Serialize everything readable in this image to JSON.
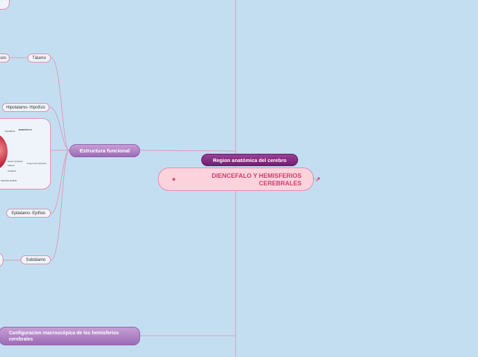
{
  "central": {
    "title": "DIENCEFALO Y HEMISFERIOS CEREBRALES",
    "icon": "brain-icon"
  },
  "region": {
    "label": "Region anatómica del cerebro"
  },
  "estructura": {
    "label": "Estructura funcional"
  },
  "configuracion": {
    "label": "Configuracion macroscópica de los hemisferios cerebrales"
  },
  "children": {
    "talamo_partial": "oro",
    "talamo": "Tálamo",
    "hipotalamo": "Hipotalamo- Hipofisis",
    "epitalamo": "Epitalamo- Epifisis",
    "subtalamo": "Subtálamo"
  },
  "image_labels": {
    "l1": "DIENCÉFALO",
    "l2": "Hipotálamo",
    "l3": "Tercer ventrículo",
    "l4": "Tálamo",
    "l5": "Cuerpo del ventrículo",
    "l6": "Cerebelo",
    "l7": "Glándula hipófisis"
  },
  "colors": {
    "background": "#c4def1",
    "connector": "#e08aa8",
    "central_fill": "#fcd2dd",
    "central_text": "#cc3e6b"
  }
}
